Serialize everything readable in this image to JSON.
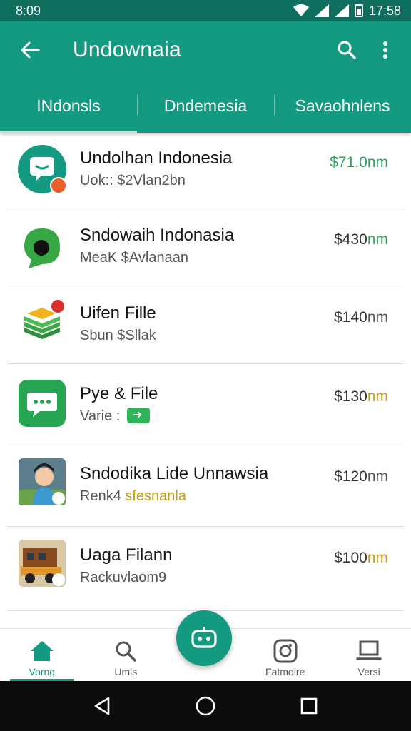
{
  "status_bar": {
    "time": "8:09",
    "clock": "17:58"
  },
  "app_bar": {
    "title": "Undownaia"
  },
  "tabs": [
    {
      "label": "INdonsls",
      "active": true
    },
    {
      "label": "Dndemesia",
      "active": false
    },
    {
      "label": "Savaohnlens",
      "active": false
    }
  ],
  "items": [
    {
      "name": "Undolhan Indonesia",
      "subtitle": "Uok:: $2Vlan2bn",
      "price": "$71.0",
      "unit": "nm",
      "icon": "chat-bubble-icon"
    },
    {
      "name": "Sndowaih Indonasia",
      "subtitle": "MeaK $Avlanaan",
      "price": "$430",
      "unit": "nm",
      "icon": "green-message-icon"
    },
    {
      "name": "Uifen Fille",
      "subtitle": "Sbun $Sllak",
      "price": "$140",
      "unit": "nm",
      "icon": "stack-layers-icon"
    },
    {
      "name": "Pye & File",
      "subtitle": "Varie :",
      "price": "$130",
      "unit": "nm",
      "icon": "message-box-icon"
    },
    {
      "name": "Sndodika Lide Unnawsia",
      "subtitle_a": "Renk4",
      "subtitle_b": "sfesnanla",
      "price": "$120",
      "unit": "nm",
      "icon": "avatar-portrait-icon"
    },
    {
      "name": "Uaga Filann",
      "subtitle": "Rackuvlaom9",
      "price": "$100",
      "unit": "nm",
      "icon": "truck-photo-icon"
    }
  ],
  "bottom_nav": [
    {
      "label": "Vorng",
      "icon": "home-icon",
      "active": true
    },
    {
      "label": "Umls",
      "icon": "search-icon",
      "active": false
    },
    {
      "label": "Fatmoire",
      "icon": "camera-icon",
      "active": false
    },
    {
      "label": "Versi",
      "icon": "laptop-icon",
      "active": false
    }
  ],
  "colors": {
    "primary": "#139a80",
    "status_bar": "#0f6f5e",
    "price_unit_green": "#2f9f62",
    "price_unit_gold": "#c69a12"
  }
}
